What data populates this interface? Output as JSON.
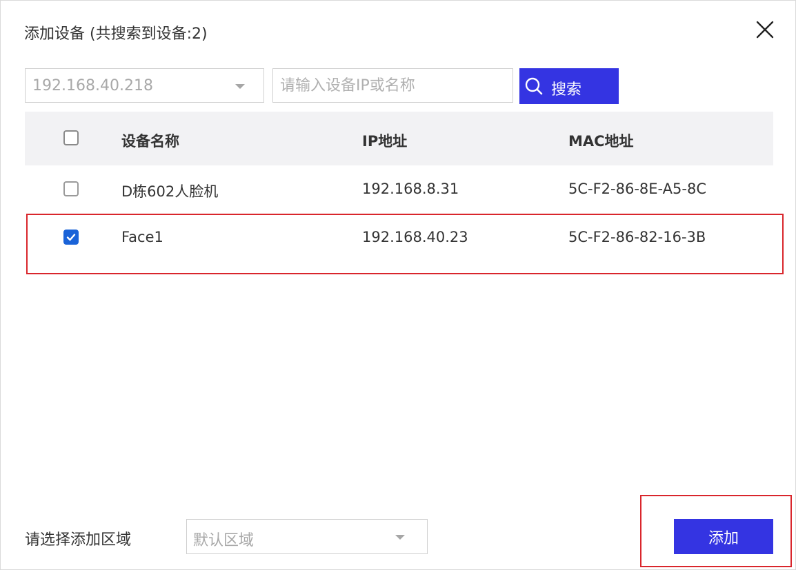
{
  "dialog": {
    "title": "添加设备 (共搜索到设备:2)"
  },
  "toolbar": {
    "ip_select_value": "192.168.40.218",
    "search_placeholder": "请输入设备IP或名称",
    "search_value": "",
    "search_label": "搜索"
  },
  "table": {
    "headers": {
      "name": "设备名称",
      "ip": "IP地址",
      "mac": "MAC地址"
    },
    "header_checked": false,
    "rows": [
      {
        "name": "D栋602人脸机",
        "ip": "192.168.8.31",
        "mac": "5C-F2-86-8E-A5-8C",
        "checked": false
      },
      {
        "name": "Face1",
        "ip": "192.168.40.23",
        "mac": "5C-F2-86-82-16-3B",
        "checked": true
      }
    ]
  },
  "footer": {
    "area_label": "请选择添加区域",
    "area_value": "默认区域",
    "add_label": "添加"
  },
  "colors": {
    "primary": "#3434e2",
    "checkbox_checked": "#1a63d8",
    "highlight": "#d9262c",
    "header_bg": "#f2f2f4"
  },
  "icons": {
    "close": "close-icon",
    "search": "search-icon",
    "dropdown": "chevron-down-icon",
    "check": "check-icon"
  }
}
